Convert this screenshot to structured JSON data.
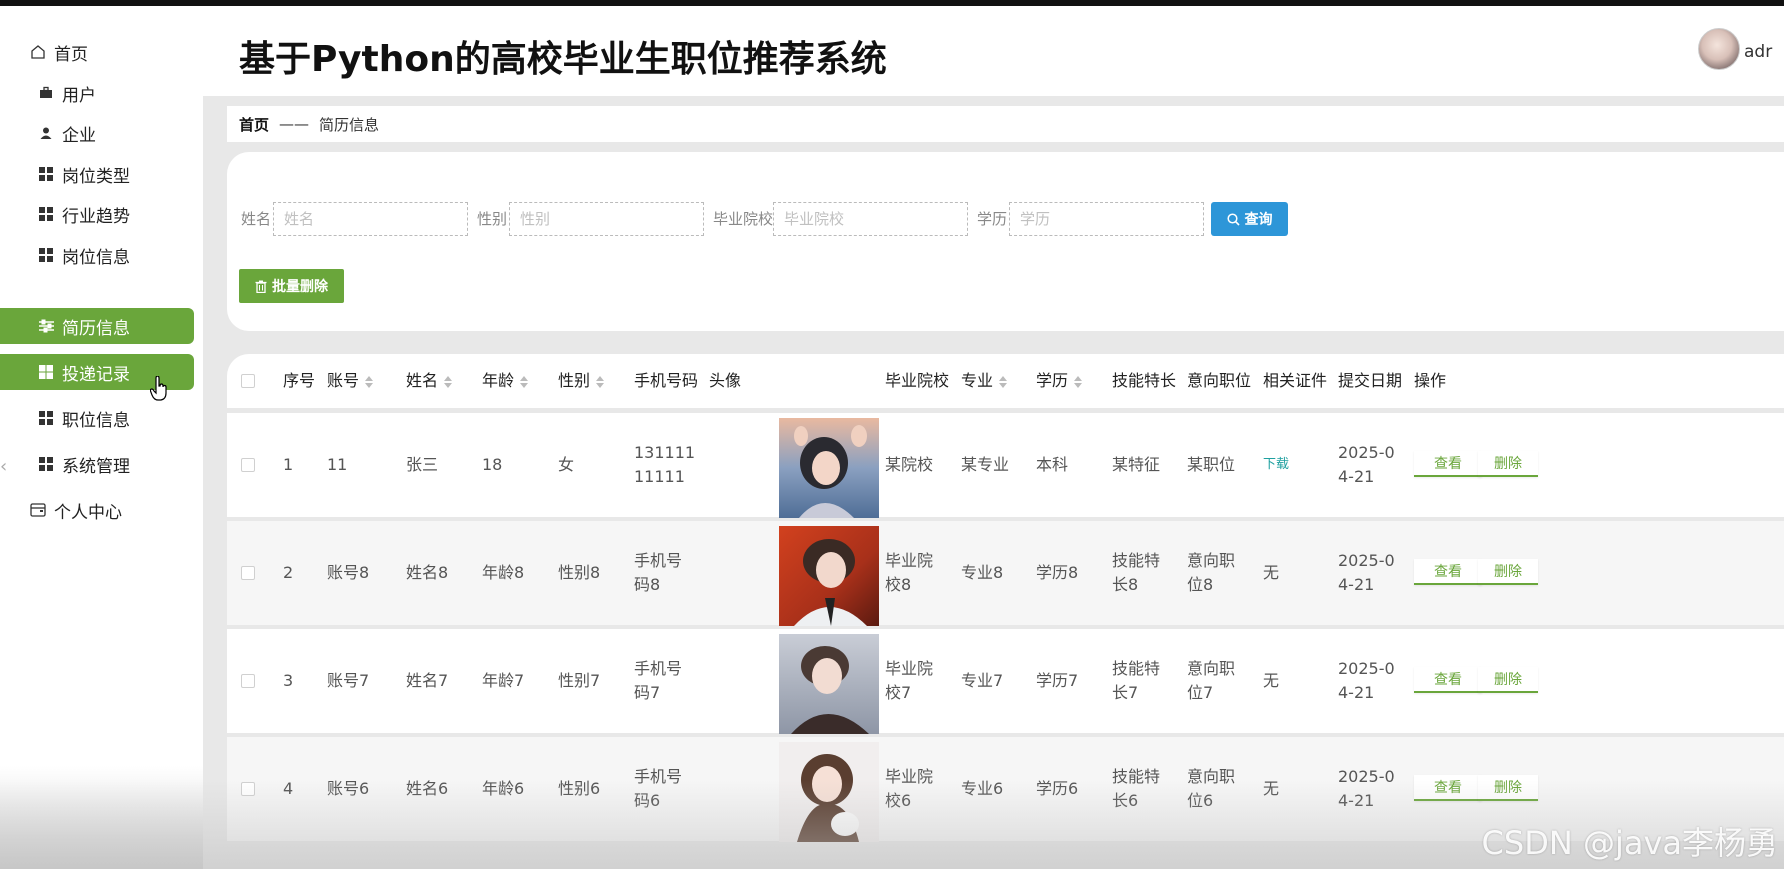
{
  "app": {
    "title": "基于Python的高校毕业生职位推荐系统",
    "user_name": "adr"
  },
  "sidebar": {
    "items": [
      {
        "label": "首页",
        "icon": "home-icon"
      },
      {
        "label": "用户",
        "icon": "briefcase-icon"
      },
      {
        "label": "企业",
        "icon": "person-icon"
      },
      {
        "label": "岗位类型",
        "icon": "grid-icon"
      },
      {
        "label": "行业趋势",
        "icon": "grid-icon"
      },
      {
        "label": "岗位信息",
        "icon": "grid-icon"
      },
      {
        "label": "简历信息",
        "icon": "sliders-icon"
      },
      {
        "label": "投递记录",
        "icon": "grid-icon"
      },
      {
        "label": "职位信息",
        "icon": "grid-icon"
      },
      {
        "label": "系统管理",
        "icon": "grid-icon"
      },
      {
        "label": "个人中心",
        "icon": "wallet-icon"
      }
    ],
    "active_color": "#6aa63b"
  },
  "breadcrumb": {
    "home": "首页",
    "separator": "——",
    "current": "简历信息"
  },
  "search": {
    "name_label": "姓名",
    "name_placeholder": "姓名",
    "gender_label": "性别",
    "gender_placeholder": "性别",
    "school_label": "毕业院校",
    "school_placeholder": "毕业院校",
    "education_label": "学历",
    "education_placeholder": "学历",
    "query_button": "查询",
    "batch_delete_button": "批量删除"
  },
  "table": {
    "headers": [
      "序号",
      "账号",
      "姓名",
      "年龄",
      "性别",
      "手机号码",
      "头像",
      "毕业院校",
      "专业",
      "学历",
      "技能特长",
      "意向职位",
      "相关证件",
      "提交日期",
      "操作"
    ],
    "rows": [
      {
        "index": "1",
        "account": "11",
        "name": "张三",
        "age": "18",
        "gender": "女",
        "phone": [
          "131111",
          "11111"
        ],
        "school": [
          "某院校"
        ],
        "major": "某专业",
        "education": "本科",
        "skills": [
          "某特征"
        ],
        "position": [
          "某职位"
        ],
        "certificate": "下载",
        "date": [
          "2025-0",
          "4-21"
        ]
      },
      {
        "index": "2",
        "account": "账号8",
        "name": "姓名8",
        "age": "年龄8",
        "gender": "性别8",
        "phone": [
          "手机号",
          "码8"
        ],
        "school": [
          "毕业院",
          "校8"
        ],
        "major": "专业8",
        "education": "学历8",
        "skills": [
          "技能特",
          "长8"
        ],
        "position": [
          "意向职",
          "位8"
        ],
        "certificate": "无",
        "date": [
          "2025-0",
          "4-21"
        ]
      },
      {
        "index": "3",
        "account": "账号7",
        "name": "姓名7",
        "age": "年龄7",
        "gender": "性别7",
        "phone": [
          "手机号",
          "码7"
        ],
        "school": [
          "毕业院",
          "校7"
        ],
        "major": "专业7",
        "education": "学历7",
        "skills": [
          "技能特",
          "长7"
        ],
        "position": [
          "意向职",
          "位7"
        ],
        "certificate": "无",
        "date": [
          "2025-0",
          "4-21"
        ]
      },
      {
        "index": "4",
        "account": "账号6",
        "name": "姓名6",
        "age": "年龄6",
        "gender": "性别6",
        "phone": [
          "手机号",
          "码6"
        ],
        "school": [
          "毕业院",
          "校6"
        ],
        "major": "专业6",
        "education": "学历6",
        "skills": [
          "技能特",
          "长6"
        ],
        "position": [
          "意向职",
          "位6"
        ],
        "certificate": "无",
        "date": [
          "2025-0",
          "4-21"
        ]
      }
    ],
    "view_button": "查看",
    "delete_button": "删除"
  },
  "watermark": "CSDN @java李杨勇"
}
